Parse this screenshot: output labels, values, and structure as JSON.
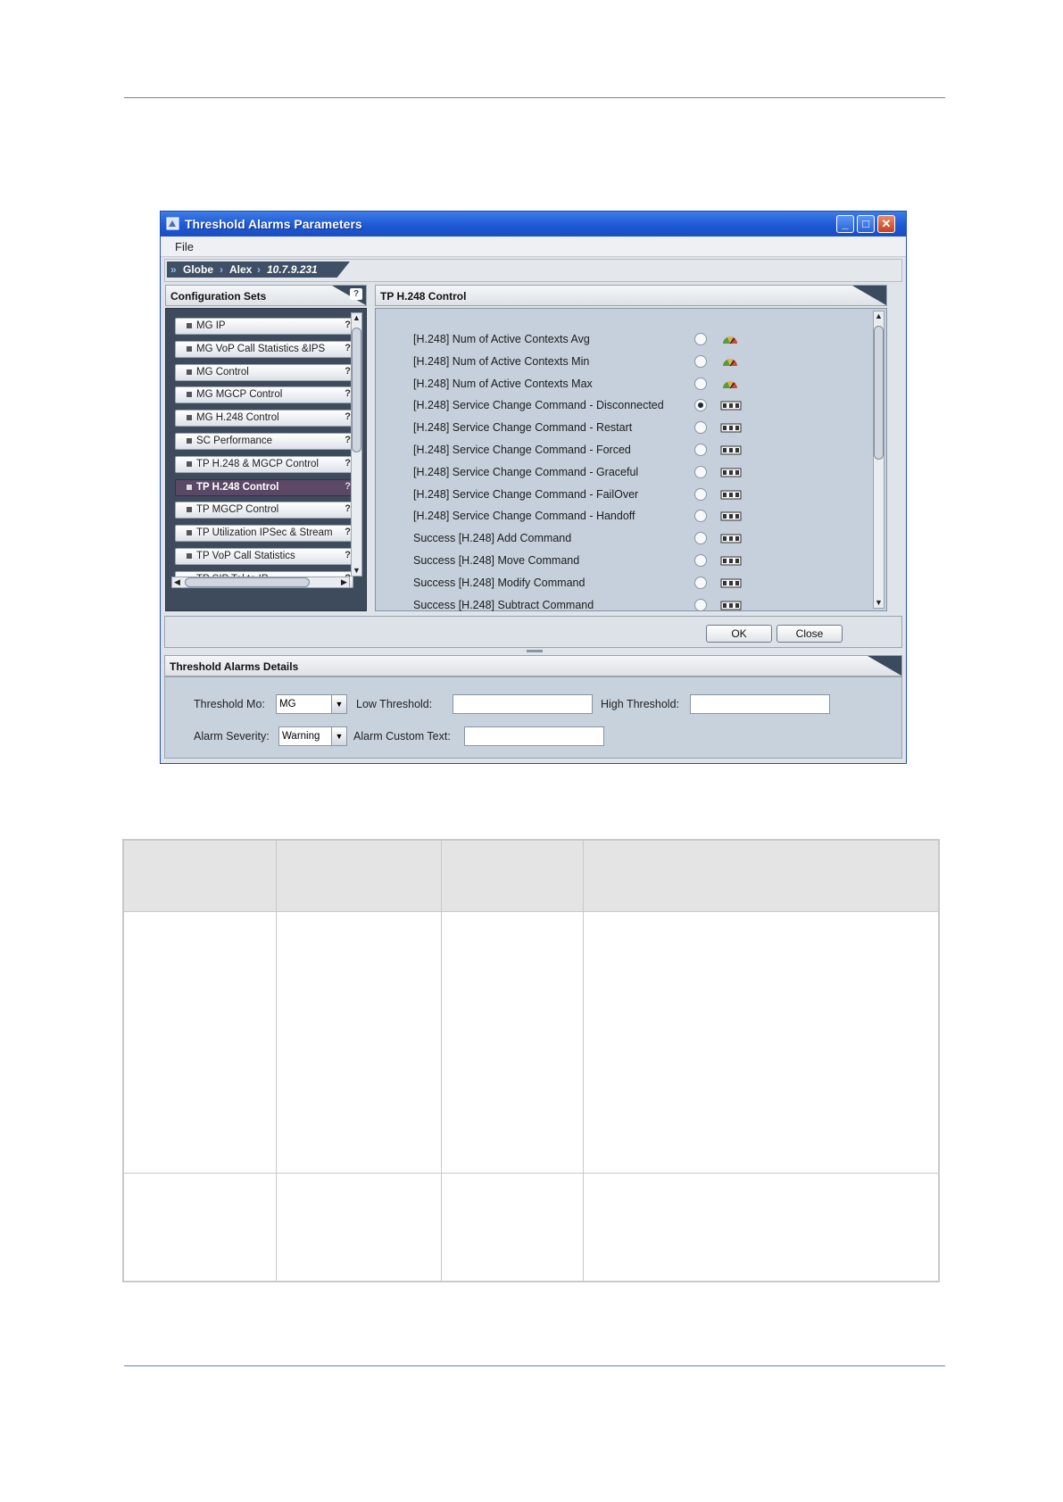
{
  "window": {
    "title": "Threshold Alarms Parameters",
    "menu_file": "File",
    "breadcrumb": [
      "Globe",
      "Alex",
      "10.7.9.231"
    ]
  },
  "config_sets": {
    "header": "Configuration Sets",
    "items": [
      {
        "label": "MG IP",
        "selected": false
      },
      {
        "label": "MG VoP Call Statistics &IPS",
        "selected": false
      },
      {
        "label": "MG Control",
        "selected": false
      },
      {
        "label": "MG MGCP Control",
        "selected": false
      },
      {
        "label": "MG H.248  Control",
        "selected": false
      },
      {
        "label": "SC Performance",
        "selected": false
      },
      {
        "label": "TP H.248 & MGCP Control",
        "selected": false
      },
      {
        "label": "TP H.248  Control",
        "selected": true
      },
      {
        "label": "TP MGCP Control",
        "selected": false
      },
      {
        "label": "TP Utilization IPSec & Stream",
        "selected": false
      },
      {
        "label": "TP VoP Call Statistics",
        "selected": false
      },
      {
        "label": "TP SIP Tel to IP",
        "selected": false
      }
    ]
  },
  "metrics": {
    "header": "TP H.248  Control",
    "items": [
      {
        "label": "[H.248] Num of Active Contexts Avg",
        "selected": false,
        "icon": "gauge-icon"
      },
      {
        "label": "[H.248] Num of Active Contexts Min",
        "selected": false,
        "icon": "gauge-icon"
      },
      {
        "label": "[H.248] Num of Active Contexts Max",
        "selected": false,
        "icon": "gauge-icon"
      },
      {
        "label": "[H.248] Service Change Command - Disconnected",
        "selected": true,
        "icon": "counter-icon"
      },
      {
        "label": "[H.248] Service Change Command - Restart",
        "selected": false,
        "icon": "counter-icon"
      },
      {
        "label": "[H.248] Service Change Command - Forced",
        "selected": false,
        "icon": "counter-icon"
      },
      {
        "label": "[H.248] Service Change Command - Graceful",
        "selected": false,
        "icon": "counter-icon"
      },
      {
        "label": "[H.248] Service Change Command - FailOver",
        "selected": false,
        "icon": "counter-icon"
      },
      {
        "label": "[H.248] Service Change Command - Handoff",
        "selected": false,
        "icon": "counter-icon"
      },
      {
        "label": "Success [H.248] Add Command",
        "selected": false,
        "icon": "counter-icon"
      },
      {
        "label": "Success [H.248] Move Command",
        "selected": false,
        "icon": "counter-icon"
      },
      {
        "label": "Success [H.248] Modify Command",
        "selected": false,
        "icon": "counter-icon"
      },
      {
        "label": "Success [H.248] Subtract Command",
        "selected": false,
        "icon": "counter-icon"
      }
    ]
  },
  "buttons": {
    "ok": "OK",
    "close": "Close"
  },
  "details": {
    "header": "Threshold Alarms Details",
    "threshold_mo_label": "Threshold Mo:",
    "threshold_mo_value": "MG",
    "low_threshold_label": "Low Threshold:",
    "low_threshold_value": "",
    "high_threshold_label": "High Threshold:",
    "high_threshold_value": "",
    "alarm_severity_label": "Alarm Severity:",
    "alarm_severity_value": "Warning",
    "alarm_custom_text_label": "Alarm Custom Text:",
    "alarm_custom_text_value": ""
  }
}
